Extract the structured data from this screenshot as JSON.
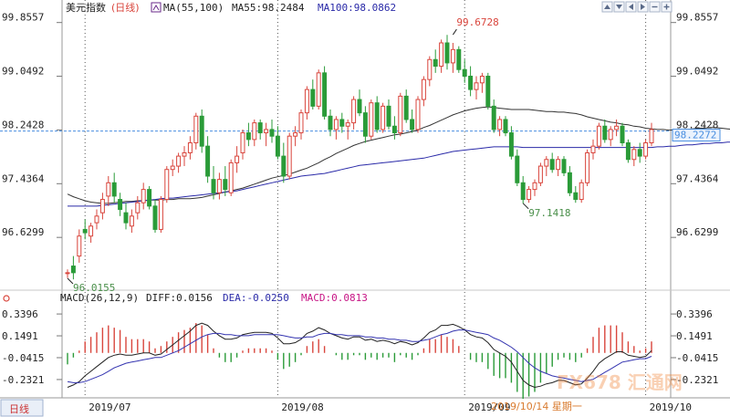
{
  "header": {
    "symbol": "美元指数",
    "period": "(日线)",
    "ma_label": "MA(55,100)",
    "ma55_label": "MA55:98.2484",
    "ma100_label": "MA100:98.0862"
  },
  "macd_header": {
    "macd_label": "MACD(26,12,9)",
    "diff_label": "DIFF:0.0156",
    "dea_label": "DEA:-0.0250",
    "macd_value_label": "MACD:0.0813"
  },
  "footer": {
    "period_button": "日线",
    "date_label": "2019/10/14 星期一",
    "watermark": "FX678 汇通网"
  },
  "colors": {
    "up": "#d9453c",
    "down": "#2a9b38",
    "ma55": "#333333",
    "ma100": "#2a2aa8",
    "diff": "#222222",
    "dea": "#3434b0",
    "last_price": "#4a8fe0"
  },
  "icons": [
    "square-icon",
    "arrow-up-icon",
    "arrow-down-icon",
    "arrow-left-icon",
    "arrow-right-icon",
    "zoom-out-icon",
    "zoom-in-icon"
  ],
  "chart_data": [
    {
      "type": "candlestick",
      "title": "美元指数(日线)",
      "yticks": [
        "99.8557",
        "99.0492",
        "98.2428",
        "97.4364",
        "96.6299"
      ],
      "ylim": [
        95.92,
        99.92
      ],
      "last_price": "98.2272",
      "annotations": [
        {
          "label": "99.6728",
          "value": 99.6728,
          "date": "2019/10/01"
        },
        {
          "label": "96.0155",
          "value": 96.0155,
          "date": "2019/06/25"
        },
        {
          "label": "97.1418",
          "value": 97.1418,
          "date": "2019/10/18"
        }
      ],
      "x_labels": [
        "2019/07",
        "2019/08",
        "2019/09",
        "2019/10"
      ],
      "series": [
        {
          "name": "MA55",
          "values": [
            97.28,
            97.24,
            97.21,
            97.18,
            97.16,
            97.15,
            97.14,
            97.14,
            97.15,
            97.16,
            97.17,
            97.17,
            97.18,
            97.18,
            97.19,
            97.19,
            97.19,
            97.2,
            97.2,
            97.21,
            97.21,
            97.21,
            97.22,
            97.23,
            97.25,
            97.27,
            97.29,
            97.31,
            97.33,
            97.35,
            97.37,
            97.4,
            97.43,
            97.46,
            97.49,
            97.52,
            97.54,
            97.56,
            97.58,
            97.61,
            97.64,
            97.67,
            97.71,
            97.75,
            97.8,
            97.84,
            97.89,
            97.93,
            97.97,
            98.01,
            98.04,
            98.07,
            98.09,
            98.11,
            98.13,
            98.15,
            98.17,
            98.18,
            98.2,
            98.22,
            98.24,
            98.28,
            98.31,
            98.35,
            98.39,
            98.43,
            98.47,
            98.5,
            98.53,
            98.55,
            98.57,
            98.58,
            98.59,
            98.58,
            98.57,
            98.56,
            98.55,
            98.55,
            98.55,
            98.55,
            98.54,
            98.53,
            98.52,
            98.52,
            98.51,
            98.51,
            98.5,
            98.49,
            98.47,
            98.44,
            98.42,
            98.4,
            98.38,
            98.36,
            98.35,
            98.33,
            98.32,
            98.3,
            98.29,
            98.27,
            98.26,
            98.25,
            98.25,
            98.24,
            98.24,
            98.24,
            98.25,
            98.26,
            98.27,
            98.27,
            98.28,
            98.28,
            98.27,
            98.26,
            98.25,
            98.24,
            98.23,
            98.23,
            98.22,
            98.21,
            98.2,
            98.2,
            98.19,
            98.19,
            98.18,
            98.18,
            98.17,
            98.17,
            98.16,
            98.16,
            98.15,
            98.15,
            98.14,
            98.14,
            98.13,
            98.13,
            98.13,
            98.13,
            98.12,
            98.12,
            98.12,
            98.12,
            98.12,
            98.11,
            98.11,
            98.11,
            98.11,
            98.11,
            98.11,
            98.11,
            98.1,
            98.1,
            98.1,
            98.1,
            98.1,
            98.1,
            98.1,
            98.1,
            98.1,
            98.09,
            98.09,
            98.09
          ]
        },
        {
          "name": "MA100",
          "values": [
            97.1,
            97.1,
            97.1,
            97.1,
            97.1,
            97.1,
            97.11,
            97.12,
            97.13,
            97.14,
            97.15,
            97.16,
            97.17,
            97.18,
            97.19,
            97.2,
            97.21,
            97.22,
            97.22,
            97.23,
            97.24,
            97.25,
            97.26,
            97.27,
            97.28,
            97.29,
            97.3,
            97.31,
            97.32,
            97.33,
            97.35,
            97.37,
            97.39,
            97.41,
            97.43,
            97.45,
            97.47,
            97.49,
            97.51,
            97.53,
            97.55,
            97.56,
            97.57,
            97.58,
            97.59,
            97.61,
            97.63,
            97.65,
            97.67,
            97.69,
            97.71,
            97.72,
            97.73,
            97.74,
            97.75,
            97.76,
            97.77,
            97.78,
            97.79,
            97.8,
            97.81,
            97.82,
            97.84,
            97.86,
            97.88,
            97.9,
            97.92,
            97.93,
            97.94,
            97.95,
            97.96,
            97.97,
            97.98,
            97.99,
            97.99,
            97.99,
            97.99,
            97.99,
            97.98,
            97.98,
            97.98,
            97.98,
            97.98,
            97.98,
            97.98,
            97.98,
            97.98,
            97.98,
            97.98,
            97.98,
            97.98,
            97.98,
            97.98,
            97.98,
            97.98,
            97.98,
            97.98,
            97.98,
            97.98,
            97.98,
            97.98,
            97.99,
            97.99,
            98.0,
            98.0,
            98.01,
            98.02,
            98.02,
            98.03,
            98.04,
            98.04,
            98.05,
            98.05,
            98.06,
            98.06,
            98.07,
            98.07,
            98.08,
            98.08,
            98.09,
            98.09,
            98.1,
            98.1,
            98.1,
            98.1,
            98.1,
            98.1,
            98.1,
            98.1,
            98.1,
            98.1,
            98.1,
            98.1,
            98.1,
            98.1,
            98.1,
            98.1,
            98.1,
            98.1,
            98.1,
            98.1,
            98.1,
            98.1,
            98.1,
            98.1,
            98.1,
            98.1,
            98.1,
            98.1,
            98.1,
            98.1,
            98.1,
            98.1,
            98.1,
            98.1,
            98.1,
            98.1,
            98.1,
            98.1,
            98.1
          ]
        }
      ],
      "candles": [
        [
          96.1,
          96.15,
          96.02,
          96.1
        ],
        [
          96.2,
          96.35,
          96.0,
          96.1
        ],
        [
          96.35,
          96.75,
          96.25,
          96.65
        ],
        [
          96.75,
          96.9,
          96.6,
          96.7
        ],
        [
          96.65,
          96.85,
          96.55,
          96.8
        ],
        [
          96.85,
          97.05,
          96.75,
          96.95
        ],
        [
          97.0,
          97.3,
          96.9,
          97.2
        ],
        [
          97.25,
          97.55,
          97.1,
          97.45
        ],
        [
          97.45,
          97.6,
          97.15,
          97.25
        ],
        [
          97.2,
          97.3,
          96.95,
          97.05
        ],
        [
          97.0,
          97.15,
          96.75,
          96.85
        ],
        [
          96.8,
          97.05,
          96.7,
          96.95
        ],
        [
          97.0,
          97.25,
          96.9,
          97.15
        ],
        [
          97.15,
          97.45,
          97.05,
          97.35
        ],
        [
          97.35,
          97.4,
          97.05,
          97.1
        ],
        [
          97.1,
          97.2,
          96.7,
          96.75
        ],
        [
          96.75,
          97.25,
          96.7,
          97.2
        ],
        [
          97.2,
          97.7,
          97.15,
          97.65
        ],
        [
          97.65,
          97.8,
          97.55,
          97.7
        ],
        [
          97.7,
          97.9,
          97.6,
          97.85
        ],
        [
          97.85,
          98.0,
          97.7,
          97.9
        ],
        [
          97.9,
          98.15,
          97.8,
          98.05
        ],
        [
          98.05,
          98.5,
          97.95,
          98.45
        ],
        [
          98.45,
          98.55,
          97.9,
          98.0
        ],
        [
          98.0,
          98.15,
          97.45,
          97.55
        ],
        [
          97.5,
          97.7,
          97.2,
          97.3
        ],
        [
          97.3,
          97.6,
          97.2,
          97.5
        ],
        [
          97.5,
          97.7,
          97.25,
          97.35
        ],
        [
          97.3,
          97.8,
          97.25,
          97.75
        ],
        [
          97.75,
          98.0,
          97.6,
          97.85
        ],
        [
          97.9,
          98.25,
          97.8,
          98.2
        ],
        [
          98.2,
          98.35,
          98.0,
          98.1
        ],
        [
          98.1,
          98.4,
          98.0,
          98.35
        ],
        [
          98.35,
          98.4,
          98.1,
          98.2
        ],
        [
          98.2,
          98.35,
          98.0,
          98.25
        ],
        [
          98.25,
          98.4,
          98.05,
          98.15
        ],
        [
          98.15,
          98.3,
          97.8,
          97.85
        ],
        [
          97.85,
          98.05,
          97.45,
          97.55
        ],
        [
          97.55,
          98.2,
          97.5,
          98.15
        ],
        [
          98.15,
          98.3,
          98.0,
          98.2
        ],
        [
          98.2,
          98.55,
          98.1,
          98.5
        ],
        [
          98.5,
          98.9,
          98.4,
          98.85
        ],
        [
          98.85,
          99.0,
          98.55,
          98.6
        ],
        [
          98.6,
          99.15,
          98.55,
          99.1
        ],
        [
          99.1,
          99.2,
          98.4,
          98.45
        ],
        [
          98.45,
          98.55,
          98.15,
          98.25
        ],
        [
          98.25,
          98.45,
          98.1,
          98.4
        ],
        [
          98.4,
          98.5,
          98.2,
          98.3
        ],
        [
          98.3,
          98.4,
          98.1,
          98.35
        ],
        [
          98.35,
          98.75,
          98.25,
          98.7
        ],
        [
          98.7,
          98.85,
          98.45,
          98.5
        ],
        [
          98.5,
          98.6,
          98.05,
          98.15
        ],
        [
          98.15,
          98.7,
          98.1,
          98.65
        ],
        [
          98.65,
          98.75,
          98.2,
          98.25
        ],
        [
          98.25,
          98.65,
          98.2,
          98.6
        ],
        [
          98.6,
          98.7,
          98.25,
          98.3
        ],
        [
          98.3,
          98.45,
          98.1,
          98.2
        ],
        [
          98.2,
          98.8,
          98.15,
          98.75
        ],
        [
          98.75,
          98.85,
          98.35,
          98.4
        ],
        [
          98.4,
          98.55,
          98.2,
          98.25
        ],
        [
          98.25,
          98.75,
          98.2,
          98.7
        ],
        [
          98.7,
          99.05,
          98.6,
          99.0
        ],
        [
          99.0,
          99.35,
          98.9,
          99.3
        ],
        [
          99.3,
          99.45,
          99.1,
          99.2
        ],
        [
          99.2,
          99.6,
          99.1,
          99.55
        ],
        [
          99.55,
          99.67,
          99.15,
          99.25
        ],
        [
          99.25,
          99.55,
          99.1,
          99.45
        ],
        [
          99.45,
          99.5,
          99.1,
          99.15
        ],
        [
          99.15,
          99.3,
          98.95,
          99.05
        ],
        [
          99.05,
          99.2,
          98.75,
          98.85
        ],
        [
          98.85,
          99.05,
          98.7,
          98.95
        ],
        [
          98.95,
          99.1,
          98.8,
          99.05
        ],
        [
          99.05,
          99.1,
          98.55,
          98.6
        ],
        [
          98.6,
          98.7,
          98.2,
          98.25
        ],
        [
          98.25,
          98.45,
          98.15,
          98.4
        ],
        [
          98.4,
          98.45,
          98.15,
          98.2
        ],
        [
          98.2,
          98.3,
          97.8,
          97.85
        ],
        [
          97.85,
          97.95,
          97.4,
          97.45
        ],
        [
          97.45,
          97.55,
          97.14,
          97.2
        ],
        [
          97.2,
          97.4,
          97.15,
          97.35
        ],
        [
          97.35,
          97.5,
          97.25,
          97.45
        ],
        [
          97.45,
          97.75,
          97.4,
          97.7
        ],
        [
          97.7,
          97.85,
          97.55,
          97.8
        ],
        [
          97.8,
          97.9,
          97.6,
          97.65
        ],
        [
          97.65,
          97.85,
          97.55,
          97.8
        ],
        [
          97.8,
          97.85,
          97.55,
          97.6
        ],
        [
          97.6,
          97.7,
          97.25,
          97.3
        ],
        [
          97.3,
          97.4,
          97.15,
          97.2
        ],
        [
          97.2,
          97.5,
          97.15,
          97.45
        ],
        [
          97.45,
          97.95,
          97.4,
          97.9
        ],
        [
          97.9,
          98.1,
          97.8,
          98.0
        ],
        [
          98.0,
          98.35,
          97.95,
          98.3
        ],
        [
          98.3,
          98.4,
          98.05,
          98.1
        ],
        [
          98.1,
          98.3,
          98.0,
          98.25
        ],
        [
          98.25,
          98.4,
          98.15,
          98.3
        ],
        [
          98.3,
          98.35,
          98.0,
          98.05
        ],
        [
          98.05,
          98.1,
          97.75,
          97.8
        ],
        [
          97.8,
          98.0,
          97.7,
          97.95
        ],
        [
          97.95,
          98.05,
          97.75,
          97.85
        ],
        [
          97.85,
          98.1,
          97.8,
          98.05
        ],
        [
          98.05,
          98.35,
          98.0,
          98.25
        ]
      ]
    },
    {
      "type": "macd",
      "title": "MACD(26,12,9)",
      "yticks": [
        "0.3396",
        "0.1491",
        "-0.0415",
        "-0.2321"
      ],
      "ylim": [
        -0.36,
        0.42
      ],
      "x_labels": [
        "2019/07",
        "2019/08",
        "2019/09",
        "2019/10"
      ],
      "diff": [
        -0.3,
        -0.28,
        -0.25,
        -0.2,
        -0.16,
        -0.12,
        -0.08,
        -0.04,
        -0.02,
        -0.01,
        -0.02,
        -0.02,
        -0.01,
        0.0,
        0.0,
        -0.02,
        -0.01,
        0.03,
        0.07,
        0.11,
        0.15,
        0.19,
        0.24,
        0.26,
        0.24,
        0.19,
        0.15,
        0.12,
        0.12,
        0.13,
        0.16,
        0.17,
        0.18,
        0.18,
        0.18,
        0.17,
        0.13,
        0.08,
        0.08,
        0.09,
        0.12,
        0.17,
        0.19,
        0.22,
        0.2,
        0.17,
        0.15,
        0.13,
        0.12,
        0.14,
        0.14,
        0.11,
        0.12,
        0.1,
        0.11,
        0.1,
        0.08,
        0.1,
        0.09,
        0.07,
        0.09,
        0.13,
        0.18,
        0.2,
        0.24,
        0.24,
        0.25,
        0.23,
        0.2,
        0.16,
        0.14,
        0.13,
        0.09,
        0.03,
        0.0,
        -0.03,
        -0.08,
        -0.16,
        -0.24,
        -0.28,
        -0.3,
        -0.29,
        -0.27,
        -0.26,
        -0.24,
        -0.24,
        -0.26,
        -0.28,
        -0.27,
        -0.22,
        -0.16,
        -0.09,
        -0.05,
        -0.02,
        0.01,
        0.01,
        -0.02,
        -0.03,
        -0.04,
        -0.03,
        0.02
      ],
      "dea": [
        -0.25,
        -0.26,
        -0.26,
        -0.25,
        -0.23,
        -0.21,
        -0.19,
        -0.16,
        -0.13,
        -0.11,
        -0.09,
        -0.08,
        -0.07,
        -0.06,
        -0.05,
        -0.04,
        -0.04,
        -0.02,
        0.0,
        0.02,
        0.05,
        0.08,
        0.11,
        0.14,
        0.16,
        0.17,
        0.17,
        0.16,
        0.16,
        0.15,
        0.15,
        0.15,
        0.16,
        0.16,
        0.16,
        0.16,
        0.16,
        0.15,
        0.14,
        0.13,
        0.13,
        0.14,
        0.14,
        0.16,
        0.17,
        0.17,
        0.16,
        0.16,
        0.15,
        0.15,
        0.15,
        0.14,
        0.14,
        0.13,
        0.13,
        0.12,
        0.12,
        0.11,
        0.11,
        0.1,
        0.1,
        0.11,
        0.12,
        0.14,
        0.16,
        0.17,
        0.19,
        0.2,
        0.2,
        0.19,
        0.18,
        0.17,
        0.16,
        0.13,
        0.11,
        0.08,
        0.05,
        0.01,
        -0.04,
        -0.09,
        -0.13,
        -0.16,
        -0.18,
        -0.2,
        -0.21,
        -0.22,
        -0.23,
        -0.24,
        -0.25,
        -0.24,
        -0.23,
        -0.2,
        -0.17,
        -0.14,
        -0.11,
        -0.08,
        -0.07,
        -0.06,
        -0.05,
        -0.05,
        -0.03
      ]
    }
  ]
}
